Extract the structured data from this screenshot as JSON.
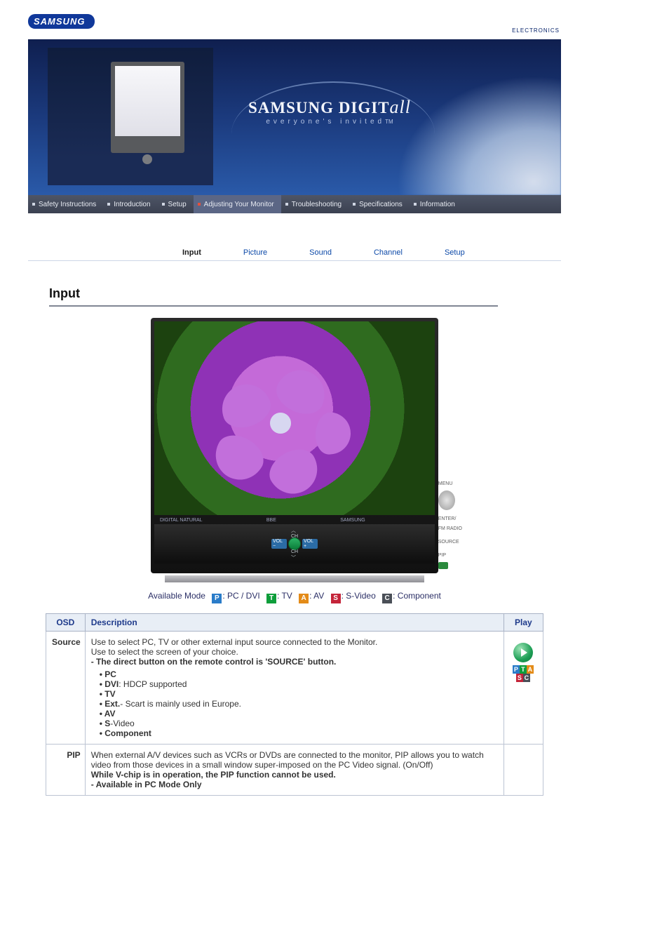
{
  "brand": {
    "name": "SAMSUNG",
    "division": "ELECTRONICS"
  },
  "banner": {
    "headline_main": "SAMSUNG DIGIT",
    "headline_script": "all",
    "tagline": "everyone's invited",
    "trademark": "TM"
  },
  "navbar": [
    {
      "label": "Safety Instructions",
      "active": false
    },
    {
      "label": "Introduction",
      "active": false
    },
    {
      "label": "Setup",
      "active": false
    },
    {
      "label": "Adjusting Your Monitor",
      "active": true
    },
    {
      "label": "Troubleshooting",
      "active": false
    },
    {
      "label": "Specifications",
      "active": false
    },
    {
      "label": "Information",
      "active": false
    }
  ],
  "subnav": {
    "items": [
      "Input",
      "Picture",
      "Sound",
      "Channel",
      "Setup"
    ],
    "selected_index": 0
  },
  "section_title": "Input",
  "side_labels": {
    "menu": "MENU",
    "enter": "ENTER/\nFM RADIO",
    "source": "SOURCE",
    "pip": "PIP"
  },
  "tv_logos": {
    "left1": "DIGITAL\nNATURAL",
    "left2": "BBE",
    "left3": "DIGITAL",
    "center": "SAMSUNG"
  },
  "tv_controls": {
    "ch": "CH",
    "vol_minus": "VOL\n−",
    "vol_plus": "VOL\n+"
  },
  "legend": {
    "prefix": "Available Mode",
    "modes": [
      {
        "code": "P",
        "label": ": PC / DVI"
      },
      {
        "code": "T",
        "label": ": TV"
      },
      {
        "code": "A",
        "label": ": AV"
      },
      {
        "code": "S",
        "label": ": S-Video"
      },
      {
        "code": "C",
        "label": ": Component"
      }
    ]
  },
  "table": {
    "headers": {
      "osd": "OSD",
      "description": "Description",
      "play": "Play"
    },
    "rows": [
      {
        "osd": "Source",
        "desc_lines": [
          "Use to select PC, TV or other external input source connected to the Monitor.",
          "Use to select the screen of your choice."
        ],
        "bold_lines": [
          "- The direct button on the remote control is 'SOURCE' button."
        ],
        "bullets": [
          "PC",
          "DVI: HDCP supported",
          "TV",
          "Ext.- Scart is mainly used in Europe.",
          "AV",
          "S-Video",
          "Component"
        ],
        "play_badges": [
          "P",
          "T",
          "A",
          "S",
          "C"
        ]
      },
      {
        "osd": "PIP",
        "desc_lines": [
          "When external A/V devices such as VCRs or DVDs are connected to the monitor, PIP allows you to watch video from those devices in a small window super-imposed on the PC Video signal. (On/Off)"
        ],
        "bold_lines": [
          "While V-chip is in operation, the PIP function cannot be used.",
          "- Available in PC Mode Only"
        ],
        "bullets": [],
        "play_badges": []
      }
    ]
  }
}
